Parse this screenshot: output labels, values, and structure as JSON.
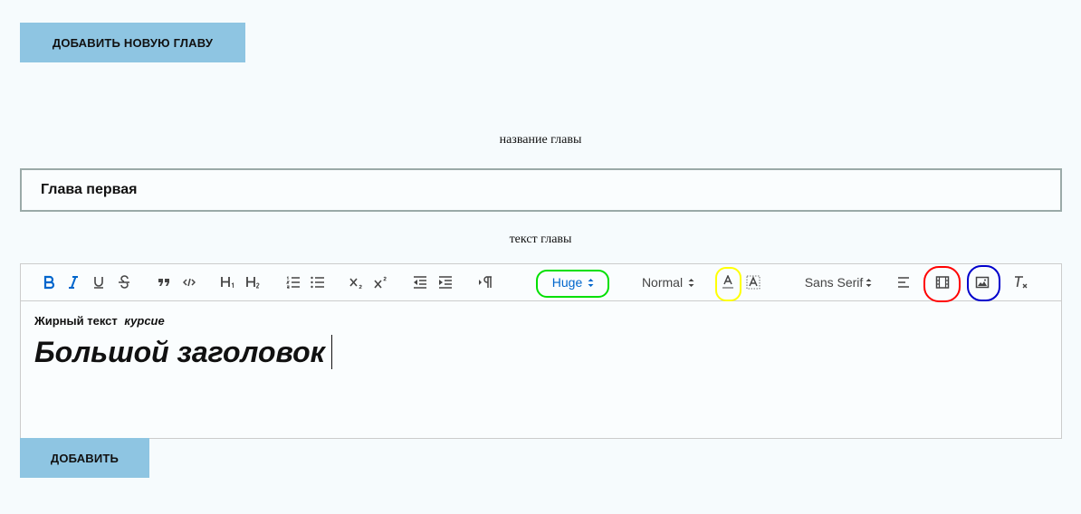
{
  "top_button": {
    "label": "ДОБАВИТЬ НОВУЮ ГЛАВУ"
  },
  "chapter_title": {
    "label": "название главы",
    "value": "Глава первая"
  },
  "chapter_text": {
    "label": "текст главы"
  },
  "toolbar": {
    "size_picker": {
      "value": "Huge",
      "color": "#06c"
    },
    "header_picker": {
      "value": "Normal"
    },
    "font_picker": {
      "value": "Sans Serif"
    },
    "buttons": [
      "bold-icon",
      "italic-icon",
      "underline-icon",
      "strike-icon",
      "blockquote-icon",
      "code-icon",
      "h1-icon",
      "h2-icon",
      "ordered-list-icon",
      "bullet-list-icon",
      "subscript-icon",
      "superscript-icon",
      "outdent-icon",
      "indent-icon",
      "rtl-icon",
      "text-color-icon",
      "background-color-icon",
      "align-icon",
      "video-icon",
      "image-icon",
      "clean-icon"
    ],
    "highlight_colors": {
      "size": "#00e000",
      "color": "#ffff00",
      "video": "#ff0000",
      "image": "#0000cc"
    }
  },
  "editor_content": {
    "bold_text": "Жирный текст",
    "italic_text": "курсие",
    "heading_text": "Большой заголовок"
  },
  "bottom_button": {
    "label": "ДОБАВИТЬ"
  }
}
